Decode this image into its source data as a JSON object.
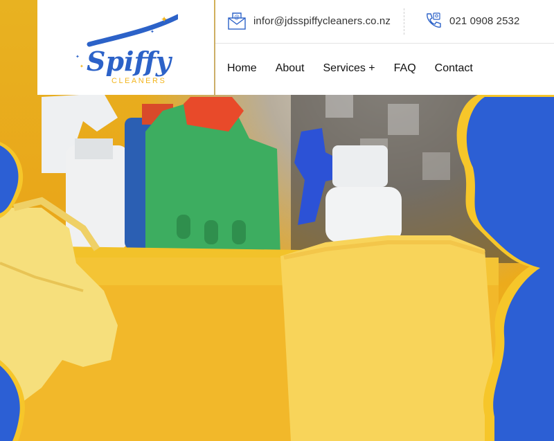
{
  "brand": {
    "logo_word": "Spiffy",
    "logo_sub": "CLEANERS",
    "primary_blue": "#2c62c8",
    "accent_gold": "#f2b51d"
  },
  "contact": {
    "email": "infor@jdsspiffycleaners.co.nz",
    "phone": "021 0908 2532",
    "email_icon": "envelope-icon",
    "phone_icon": "phone-icon"
  },
  "nav": {
    "items": [
      {
        "label": "Home"
      },
      {
        "label": "About"
      },
      {
        "label": "Services +"
      },
      {
        "label": "FAQ"
      },
      {
        "label": "Contact"
      }
    ]
  },
  "hero": {
    "image": "cleaning-supplies-photo",
    "shape_color": "#2c5fd4",
    "edge_color": "#f6c62a"
  }
}
